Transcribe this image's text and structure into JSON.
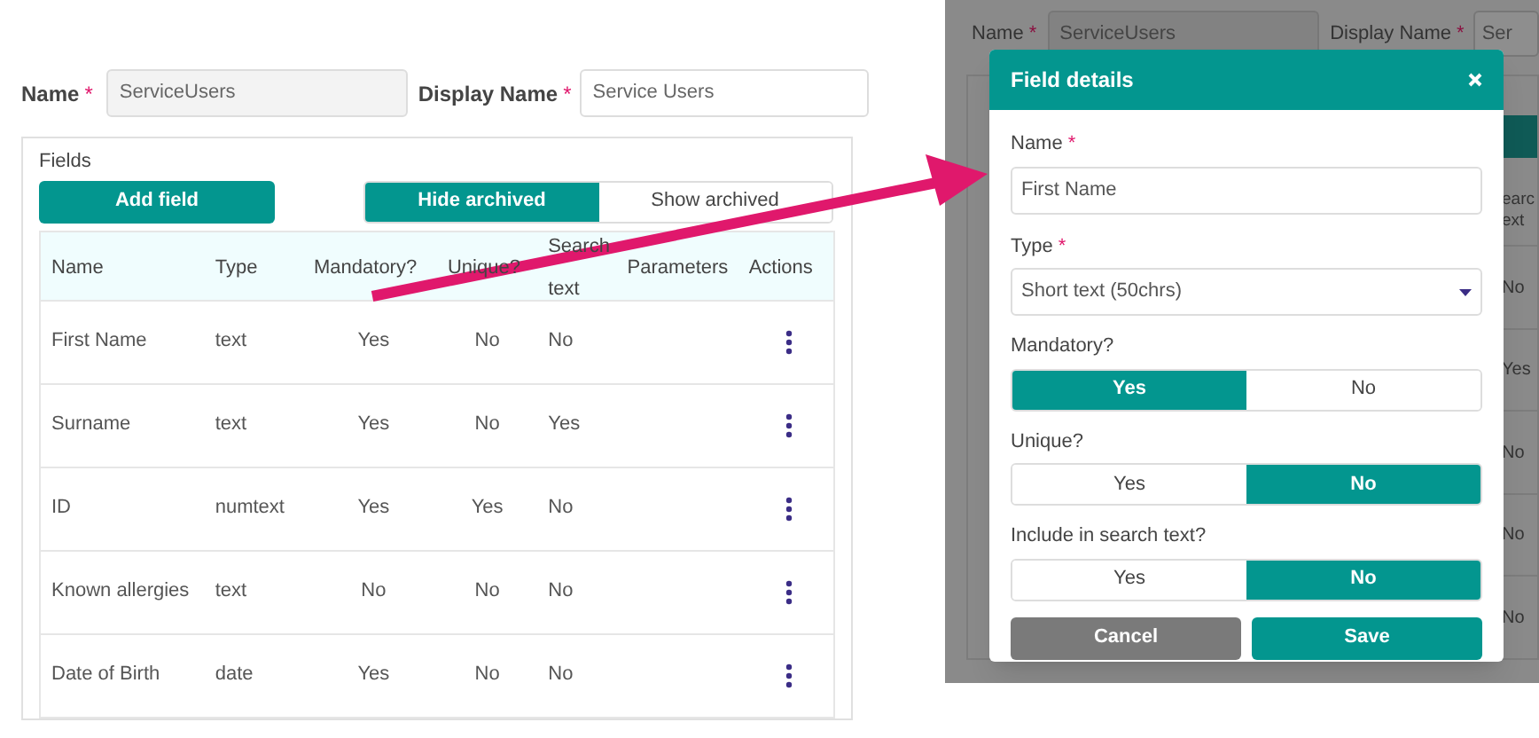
{
  "form": {
    "name_label": "Name",
    "name_required": "*",
    "name_value": "ServiceUsers",
    "display_label": "Display Name",
    "display_required": "*",
    "display_value": "Service Users"
  },
  "fields": {
    "title": "Fields",
    "add_button": "Add field",
    "archive_toggle": [
      {
        "label": "Hide archived",
        "selected": true
      },
      {
        "label": "Show archived",
        "selected": false
      }
    ],
    "columns": [
      "Name",
      "Type",
      "Mandatory?",
      "Unique?",
      "Search text",
      "Parameters",
      "Actions"
    ],
    "rows": [
      {
        "name": "First Name",
        "type": "text",
        "mandatory": "Yes",
        "unique": "No",
        "search": "No"
      },
      {
        "name": "Surname",
        "type": "text",
        "mandatory": "Yes",
        "unique": "No",
        "search": "Yes"
      },
      {
        "name": "ID",
        "type": "numtext",
        "mandatory": "Yes",
        "unique": "Yes",
        "search": "No"
      },
      {
        "name": "Known allergies",
        "type": "text",
        "mandatory": "No",
        "unique": "No",
        "search": "No"
      },
      {
        "name": "Date of Birth",
        "type": "date",
        "mandatory": "Yes",
        "unique": "No",
        "search": "No"
      }
    ]
  },
  "background": {
    "name_label": "Name",
    "name_required": "*",
    "name_value": "ServiceUsers",
    "display_label": "Display Name",
    "display_required": "*",
    "display_value": "Ser",
    "header_lines": [
      "earc",
      "ext"
    ],
    "values": [
      "No",
      "Yes",
      "No",
      "No",
      "No"
    ]
  },
  "dialog": {
    "title": "Field details",
    "name_label": "Name",
    "name_required": "*",
    "name_value": "First Name",
    "type_label": "Type",
    "type_required": "*",
    "type_value": "Short text (50chrs)",
    "toggles": [
      {
        "label": "Mandatory?",
        "options": [
          {
            "label": "Yes",
            "selected": true
          },
          {
            "label": "No",
            "selected": false
          }
        ]
      },
      {
        "label": "Unique?",
        "options": [
          {
            "label": "Yes",
            "selected": false
          },
          {
            "label": "No",
            "selected": true
          }
        ]
      },
      {
        "label": "Include in search text?",
        "options": [
          {
            "label": "Yes",
            "selected": false
          },
          {
            "label": "No",
            "selected": true
          }
        ]
      }
    ],
    "cancel": "Cancel",
    "save": "Save"
  }
}
